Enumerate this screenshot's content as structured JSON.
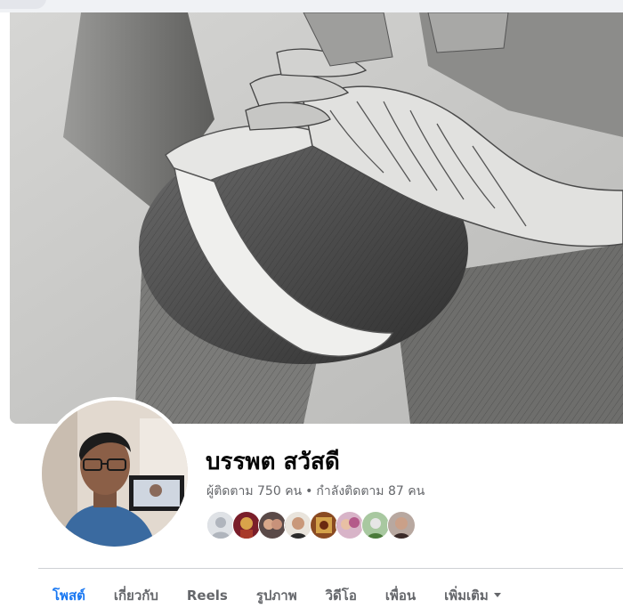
{
  "profile": {
    "name": "บรรพต สวัสดี",
    "followers": "ผู้ติดตาม 750 คน",
    "separator": "•",
    "following": "กำลังติดตาม 87 คน"
  },
  "tabs": [
    {
      "label": "โพสต์",
      "active": true
    },
    {
      "label": "เกี่ยวกับ"
    },
    {
      "label": "Reels"
    },
    {
      "label": "รูปภาพ"
    },
    {
      "label": "วิดีโอ"
    },
    {
      "label": "เพื่อน"
    },
    {
      "label": "เพิ่มเติม",
      "dropdown": true
    }
  ],
  "colors": {
    "accent": "#1877f2",
    "muted_text": "#65676b",
    "primary_text": "#050505"
  },
  "icons": {
    "more_dropdown": "caret-down-icon"
  }
}
